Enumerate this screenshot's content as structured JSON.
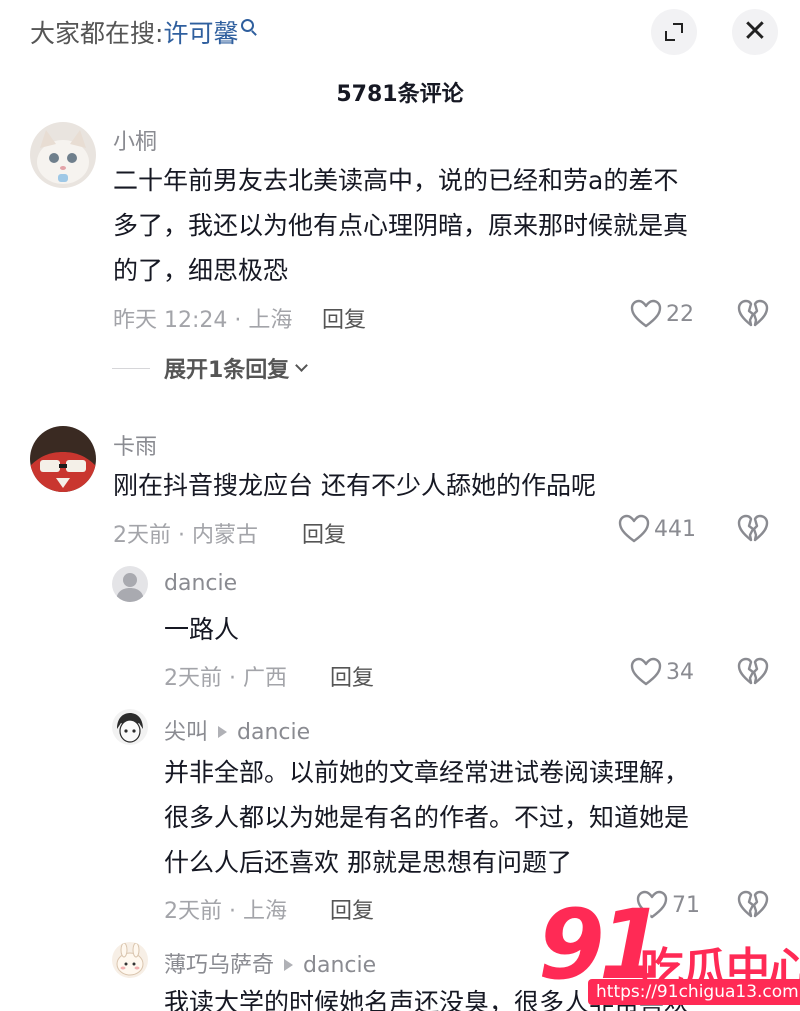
{
  "header": {
    "search_prefix": "大家都在搜:",
    "search_term": "许可馨",
    "expand_icon": "expand-icon",
    "close_icon": "close-icon",
    "close_glyph": "✕"
  },
  "comment_count": "5781条评论",
  "comments": [
    {
      "user": "小桐",
      "lines": [
        "二十年前男友去北美读高中，说的已经和劳a的差不",
        "多了，我还以为他有点心理阴暗，原来那时候就是真",
        "的了，细思极恐"
      ],
      "meta": "昨天 12:24 · 上海",
      "reply_label": "回复",
      "likes": "22",
      "expand_replies": "展开1条回复"
    },
    {
      "user": "卡雨",
      "lines": [
        "刚在抖音搜龙应台 还有不少人舔她的作品呢"
      ],
      "meta": "2天前 · 内蒙古",
      "reply_label": "回复",
      "likes": "441"
    }
  ],
  "replies": [
    {
      "user": "dancie",
      "lines": [
        "一路人"
      ],
      "meta": "2天前 · 广西",
      "reply_label": "回复",
      "likes": "34"
    },
    {
      "user": "尖叫",
      "reply_to": "dancie",
      "lines": [
        "并非全部。以前她的文章经常进试卷阅读理解，",
        "很多人都以为她是有名的作者。不过，知道她是",
        "什么人后还喜欢 那就是思想有问题了"
      ],
      "meta": "2天前 · 上海",
      "reply_label": "回复",
      "likes": "71"
    },
    {
      "user": "薄巧乌萨奇",
      "reply_to": "dancie",
      "lines": [
        "我读大学的时候她名声还没臭，很多人非常喜欢"
      ]
    }
  ],
  "watermark": {
    "logo_number": "91",
    "logo_text": "吃瓜中心",
    "url": "https://91chigua13.com"
  },
  "colors": {
    "link_blue": "#2f5f9e",
    "watermark_red": "#ff2a55",
    "text": "#161823",
    "meta_gray": "#a3a4a9"
  }
}
